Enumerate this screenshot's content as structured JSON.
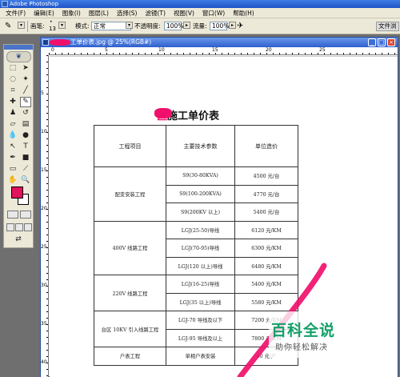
{
  "app": {
    "title": "Adobe Photoshop"
  },
  "menu": [
    "文件(F)",
    "编辑(E)",
    "图象(I)",
    "图层(L)",
    "选择(S)",
    "滤镜(T)",
    "视图(V)",
    "窗口(W)",
    "帮助(H)"
  ],
  "options": {
    "brush_label": "画笔:",
    "brush_size": "13",
    "mode_label": "模式:",
    "mode_value": "正常",
    "opacity_label": "不透明度:",
    "opacity_value": "100%",
    "flow_label": "流量:",
    "flow_value": "100%",
    "docked_label": "文件浏"
  },
  "document": {
    "title": "工单价表.jpg @ 25%(RGB#)",
    "ruler_top": [
      "0",
      "5",
      "10",
      "15",
      "20",
      "25"
    ],
    "ruler_left": [
      "5",
      "10",
      "15",
      "20",
      "25",
      "30",
      "35",
      "40"
    ]
  },
  "content": {
    "heading_prefix": "区",
    "heading": "施工单价表",
    "table": {
      "headers": [
        "工程项目",
        "主要技术参数",
        "单位造价"
      ],
      "rows": [
        {
          "project": "配变安装工程",
          "params": [
            "S9(30-80KVA)",
            "S9(100-200KVA)",
            "S9(200KV 以上)"
          ],
          "prices": [
            "4500 元/台",
            "4770 元/台",
            "5400 元/台"
          ]
        },
        {
          "project": "400V 线路工程",
          "params": [
            "LGJ(25-50)导线",
            "LGJ(70-95)导线",
            "LGJ(120 以上)导线"
          ],
          "prices": [
            "6120 元/KM",
            "6300 元/KM",
            "6480 元/KM"
          ]
        },
        {
          "project": "220V 线路工程",
          "params": [
            "LGJ(16-25)导线",
            "LGJ(35 以上)导线"
          ],
          "prices": [
            "5400 元/KM",
            "5580 元/KM"
          ]
        },
        {
          "project": "台区 10KV 引入线路工程",
          "params": [
            "LGJ-70 导线及以下",
            "LGJ-95 导线及以上"
          ],
          "prices": [
            "7200 元/KM",
            "7800 元/KM"
          ]
        },
        {
          "project": "户表工程",
          "params": [
            "单相户表安装"
          ],
          "prices": [
            "40 元/户"
          ]
        }
      ]
    }
  },
  "watermark": {
    "title": "百科全说",
    "subtitle": "助你轻松解决"
  },
  "colors": {
    "foreground": "#e0135b",
    "background": "#ffffff",
    "watermark": "#13a06a"
  }
}
